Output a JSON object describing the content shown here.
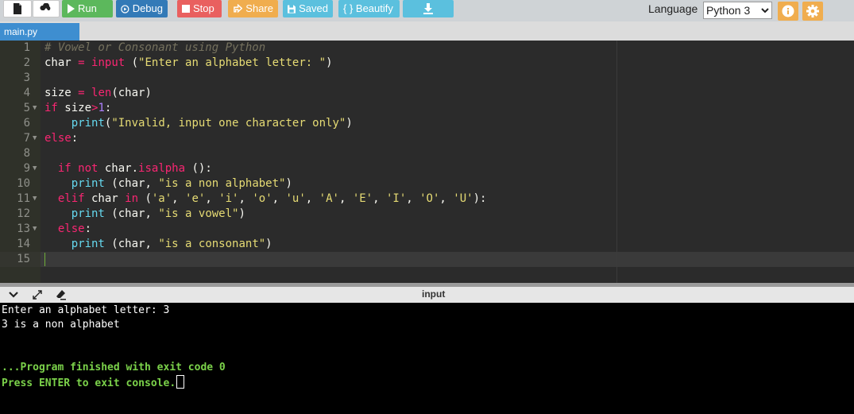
{
  "toolbar": {
    "run_label": "Run",
    "debug_label": "Debug",
    "stop_label": "Stop",
    "share_label": "Share",
    "saved_label": "Saved",
    "beautify_label": "{ } Beautify",
    "language_label": "Language",
    "language_value": "Python 3"
  },
  "tab": {
    "filename": "main.py"
  },
  "editor": {
    "line_numbers": [
      "1",
      "2",
      "3",
      "4",
      "5",
      "6",
      "7",
      "8",
      "9",
      "10",
      "11",
      "12",
      "13",
      "14",
      "15"
    ],
    "lines": {
      "l1": "# Vowel or Consonant using Python",
      "l2a": "char ",
      "l2b": "=",
      "l2c": " ",
      "l2d": "input",
      "l2e": " (",
      "l2f": "\"Enter an alphabet letter: \"",
      "l2g": ")",
      "l4a": "size ",
      "l4b": "=",
      "l4c": " ",
      "l4d": "len",
      "l4e": "(char)",
      "l5a": "if",
      "l5b": " size",
      "l5c": ">",
      "l5d": "1",
      "l5e": ":",
      "l6a": "    ",
      "l6b": "print",
      "l6c": "(",
      "l6d": "\"Invalid, input one character only\"",
      "l6e": ")",
      "l7a": "else",
      "l7b": ":",
      "l9a": "  ",
      "l9b": "if",
      "l9c": " ",
      "l9d": "not",
      "l9e": " char.",
      "l9f": "isalpha",
      "l9g": " ():",
      "l10a": "    ",
      "l10b": "print",
      "l10c": " (char, ",
      "l10d": "\"is a non alphabet\"",
      "l10e": ")",
      "l11a": "  ",
      "l11b": "elif",
      "l11c": " char ",
      "l11d": "in",
      "l11e": " (",
      "l11f": "'a'",
      "l11g": ", ",
      "l11h": "'e'",
      "l11i": ", ",
      "l11j": "'i'",
      "l11k": ", ",
      "l11l": "'o'",
      "l11m": ", ",
      "l11n": "'u'",
      "l11o": ", ",
      "l11p": "'A'",
      "l11q": ", ",
      "l11r": "'E'",
      "l11s": ", ",
      "l11t": "'I'",
      "l11u": ", ",
      "l11v": "'O'",
      "l11w": ", ",
      "l11x": "'U'",
      "l11y": "):",
      "l12a": "    ",
      "l12b": "print",
      "l12c": " (char, ",
      "l12d": "\"is a vowel\"",
      "l12e": ")",
      "l13a": "  ",
      "l13b": "else",
      "l13c": ":",
      "l14a": "    ",
      "l14b": "print",
      "l14c": " (char, ",
      "l14d": "\"is a consonant\"",
      "l14e": ")"
    }
  },
  "panel": {
    "title": "input"
  },
  "console": {
    "line1": "Enter an alphabet letter: 3",
    "line2": "3 is a non alphabet",
    "line3": "...Program finished with exit code 0",
    "line4": "Press ENTER to exit console."
  },
  "colors": {
    "run": "#5cb85c",
    "debug": "#337ab7",
    "stop": "#e9605f",
    "share": "#f0ad4e",
    "saved": "#5bc0de",
    "tab": "#3e8ed0",
    "console_green": "#7bd24a"
  }
}
